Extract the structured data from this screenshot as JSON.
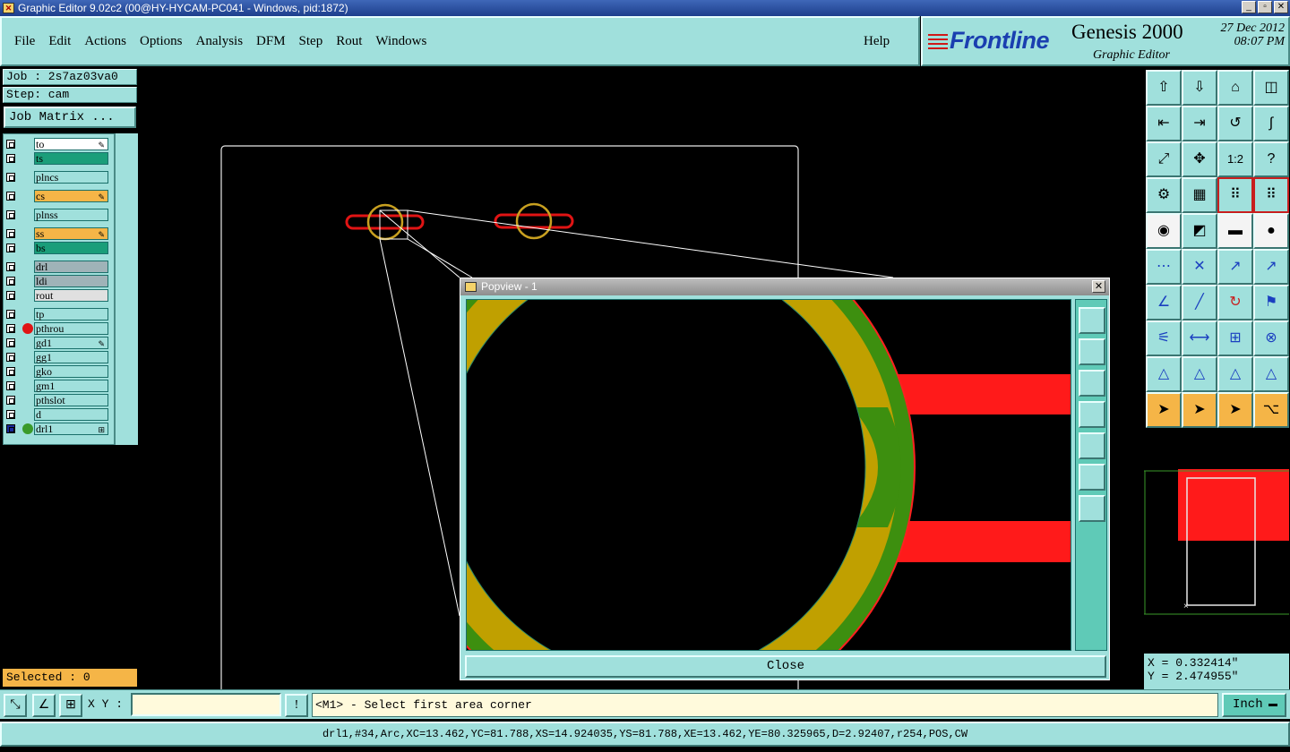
{
  "window": {
    "title": "Graphic Editor 9.02c2 (00@HY-HYCAM-PC041 - Windows, pid:1872)",
    "controls": [
      "minimize",
      "restore",
      "close"
    ]
  },
  "menu": {
    "items": [
      "File",
      "Edit",
      "Actions",
      "Options",
      "Analysis",
      "DFM",
      "Step",
      "Rout",
      "Windows"
    ],
    "help": "Help"
  },
  "brand": {
    "logo": "Frontline",
    "product": "Genesis 2000",
    "subtitle": "Graphic Editor",
    "date": "27 Dec 2012",
    "time": "08:07 PM"
  },
  "job": {
    "job_label": "Job : 2s7az03va0",
    "step_label": "Step: cam",
    "matrix_button": "Job Matrix ..."
  },
  "layers": [
    {
      "name": "to",
      "color": "#ffffff",
      "pen": true,
      "dot": ""
    },
    {
      "name": "ts",
      "color": "#1a9e7a",
      "pen": false,
      "dot": ""
    },
    {
      "name": "plncs",
      "color": "#a0e0dc",
      "pen": false,
      "dot": ""
    },
    {
      "name": "cs",
      "color": "#f5b547",
      "pen": true,
      "dot": ""
    },
    {
      "name": "plnss",
      "color": "#a0e0dc",
      "pen": false,
      "dot": ""
    },
    {
      "name": "ss",
      "color": "#f5b547",
      "pen": true,
      "dot": ""
    },
    {
      "name": "bs",
      "color": "#1a9e7a",
      "pen": false,
      "dot": ""
    },
    {
      "name": "drl",
      "color": "#9fb3b8",
      "pen": false,
      "dot": ""
    },
    {
      "name": "ldi",
      "color": "#9fb3b8",
      "pen": false,
      "dot": ""
    },
    {
      "name": "rout",
      "color": "#e0e0e0",
      "pen": false,
      "dot": ""
    },
    {
      "name": "tp",
      "color": "#a0e0dc",
      "pen": false,
      "dot": ""
    },
    {
      "name": "pthrou",
      "color": "#a0e0dc",
      "pen": false,
      "dot": "#e01414"
    },
    {
      "name": "gd1",
      "color": "#a0e0dc",
      "pen": true,
      "dot": ""
    },
    {
      "name": "gg1",
      "color": "#a0e0dc",
      "pen": false,
      "dot": ""
    },
    {
      "name": "gko",
      "color": "#a0e0dc",
      "pen": false,
      "dot": ""
    },
    {
      "name": "gm1",
      "color": "#a0e0dc",
      "pen": false,
      "dot": ""
    },
    {
      "name": "pthslot",
      "color": "#a0e0dc",
      "pen": false,
      "dot": ""
    },
    {
      "name": "d",
      "color": "#a0e0dc",
      "pen": false,
      "dot": ""
    },
    {
      "name": "drl1",
      "color": "#a0e0dc",
      "pen": false,
      "dot": "#3a9a2a",
      "active": true
    }
  ],
  "selected": "Selected : 0",
  "popview": {
    "title": "Popview - 1",
    "close_label": "Close",
    "tools": [
      "zoom-home-icon",
      "pan-up-icon",
      "pan-down-icon",
      "pan-left-icon",
      "pan-right-icon",
      "zoom-in-icon",
      "zoom-out-icon"
    ]
  },
  "toolbar": {
    "buttons": [
      "zoom-in-icon",
      "zoom-out-icon",
      "home-icon",
      "window-split-icon",
      "pan-left-icon",
      "pan-right-icon",
      "flip-icon",
      "swap-icon",
      "fit-icon",
      "center-icon",
      "ratio-label-icon",
      "help-icon",
      "settings-icon",
      "grid-icon",
      "snap-icon",
      "snap-all-icon",
      "pad-icon",
      "select-area-icon",
      "ruler-icon",
      "dot-icon",
      "nodes-icon",
      "cross-icon",
      "arrow-red-icon",
      "arrow-blue-icon",
      "angle-icon",
      "line-icon",
      "arc-icon",
      "flag-icon",
      "measure-icon",
      "dimension-icon",
      "compare-icon",
      "layers-icon",
      "triangle-a-icon",
      "triangle-b-icon",
      "triangle-c-icon",
      "triangle-d-icon",
      "pointer-icon",
      "pointer-frame-icon",
      "pointer-box-icon",
      "route-icon"
    ],
    "ratio_text": "1:2"
  },
  "coords": {
    "x": "X = 0.332414\"",
    "y": "Y = 2.474955\""
  },
  "status": {
    "xy_label": "X Y :",
    "xy_value": "",
    "prompt": "<M1> - Select first area corner",
    "units": "Inch",
    "info": "drl1,#34,Arc,XC=13.462,YC=81.788,XS=14.924035,YS=81.788,XE=13.462,YE=80.325965,D=2.92407,r254,POS,CW"
  },
  "colors": {
    "panel": "#a0e0dc",
    "accent_orange": "#f5b547",
    "trace_red": "#e01414",
    "pad_gold": "#c8a020",
    "drill_green": "#3a9a2a"
  }
}
